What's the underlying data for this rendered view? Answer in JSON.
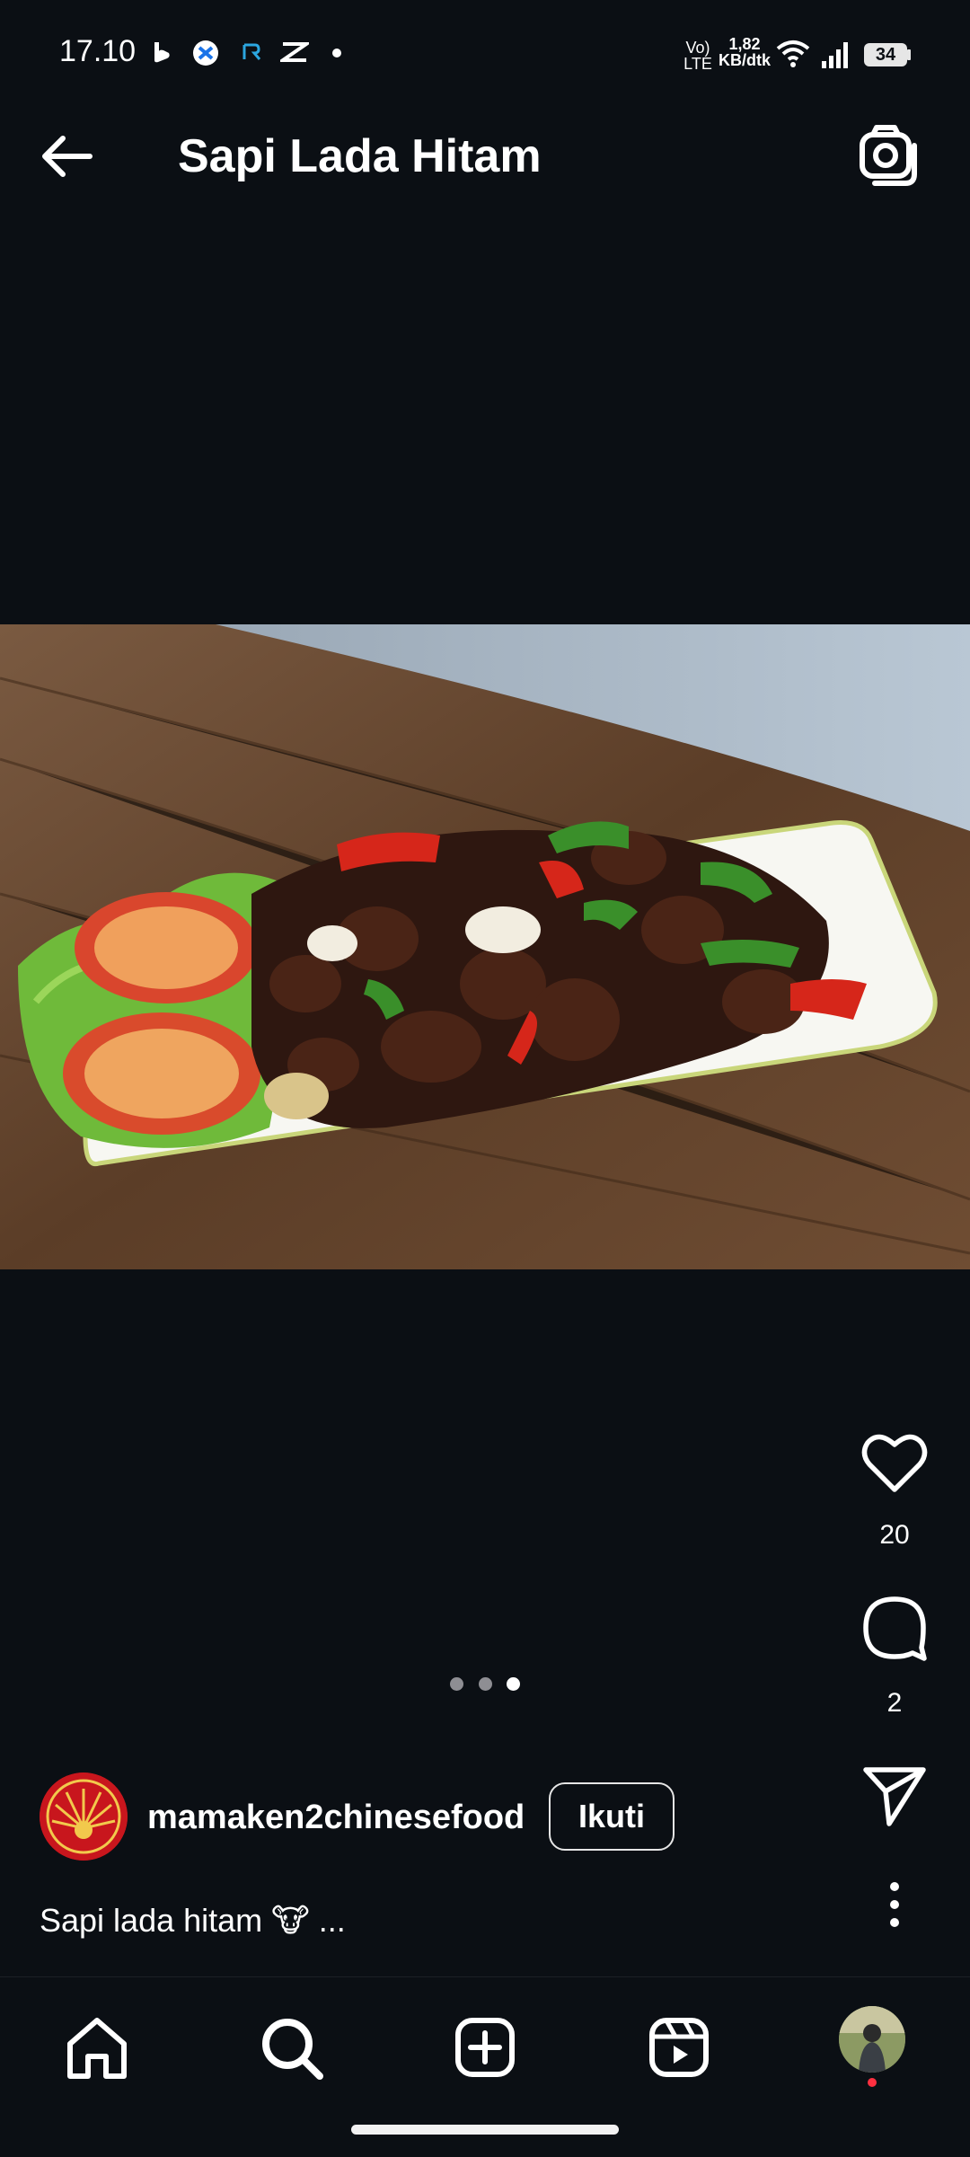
{
  "status_bar": {
    "time": "17.10",
    "net_type_top": "Vo)",
    "net_type_bottom": "LTE",
    "speed_top": "1,82",
    "speed_bottom": "KB/dtk",
    "battery": "34",
    "icons": [
      "b-app-icon",
      "x-app-icon",
      "r-app-icon",
      "capcut-icon",
      "dot-icon",
      "wifi-icon",
      "signal-icon",
      "battery-icon"
    ]
  },
  "header": {
    "title": "Sapi Lada Hitam",
    "back_icon": "arrow-left-icon",
    "camera_icon": "camera-icon"
  },
  "post": {
    "image_alt": "beef black pepper dish on white plate with tomatoes and lettuce",
    "carousel": {
      "count": 3,
      "active_index": 2
    },
    "likes": "20",
    "comments": "2",
    "author": "mamaken2chinesefood",
    "follow_label": "Ikuti",
    "caption": "Sapi lada hitam 🐮 ..."
  },
  "nav": {
    "items": [
      "home-icon",
      "search-icon",
      "create-icon",
      "reels-icon",
      "profile-avatar"
    ]
  },
  "colors": {
    "background": "#0b0f14",
    "text": "#ffffff",
    "brand_red": "#c8161d",
    "notification": "#ff3040"
  }
}
